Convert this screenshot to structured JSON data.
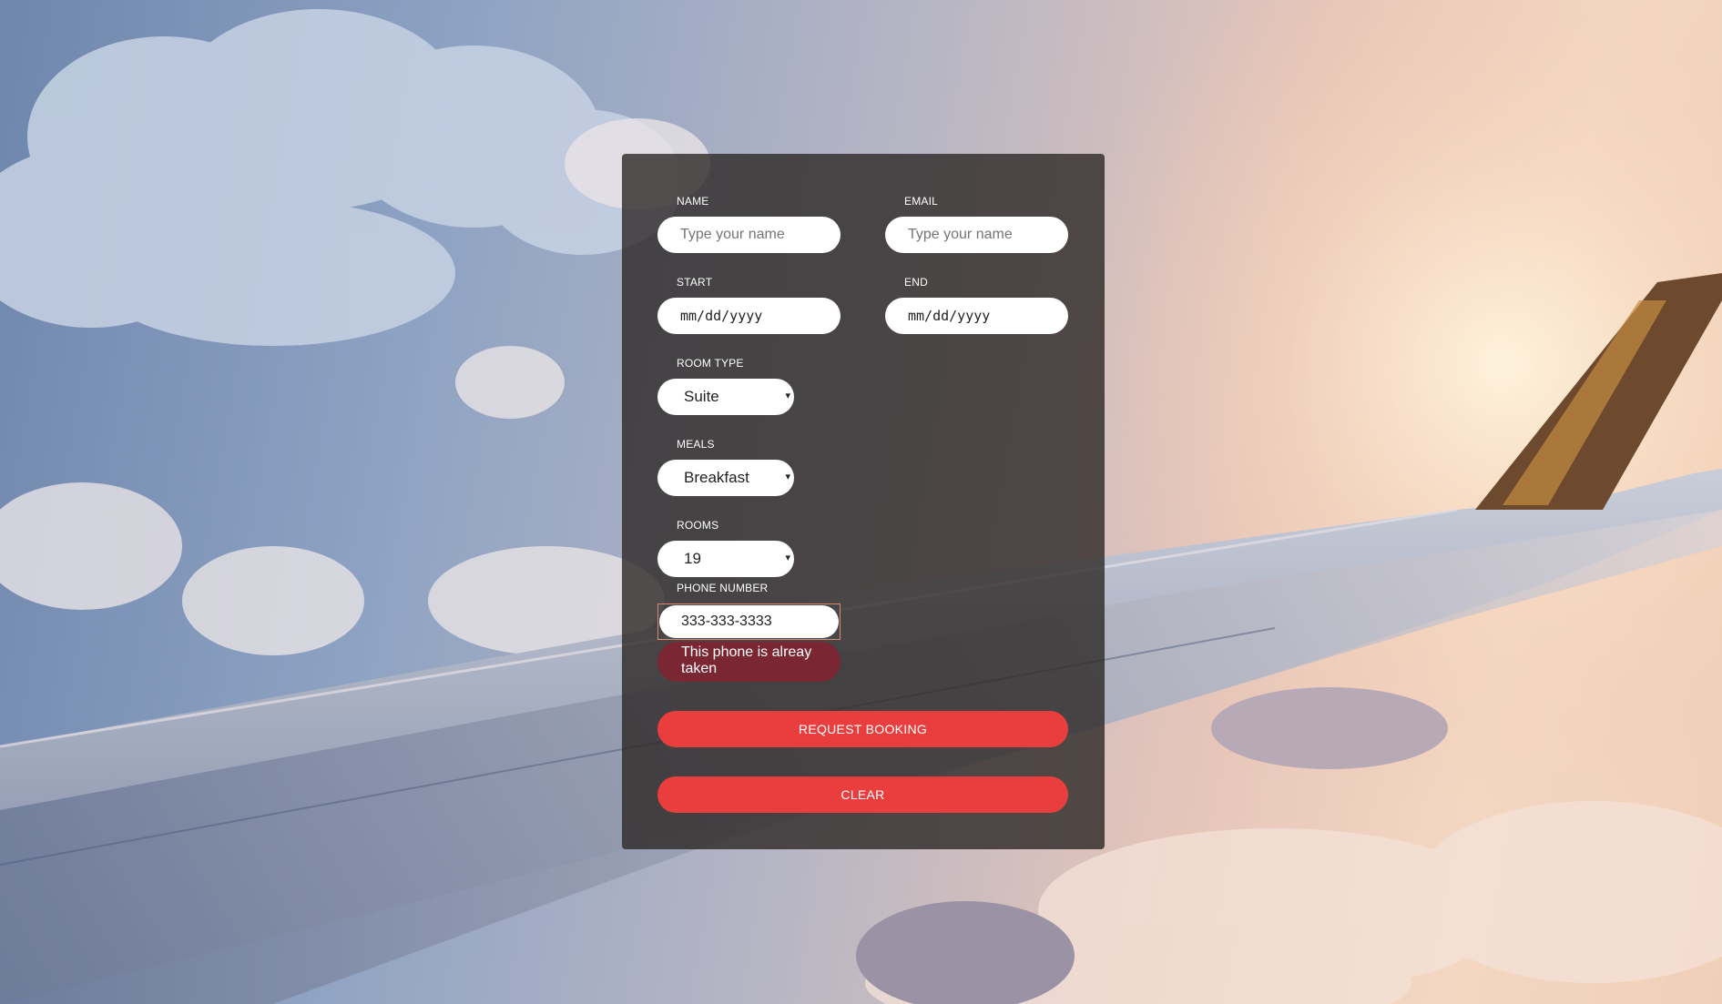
{
  "form": {
    "name": {
      "label": "NAME",
      "placeholder": "Type your name",
      "value": ""
    },
    "email": {
      "label": "EMAIL",
      "placeholder": "Type your name",
      "value": ""
    },
    "start": {
      "label": "START",
      "value": "mm/dd/yyyy"
    },
    "end": {
      "label": "END",
      "value": "mm/dd/yyyy"
    },
    "room_type": {
      "label": "ROOM TYPE",
      "selected": "Suite"
    },
    "meals": {
      "label": "MEALS",
      "selected": "Breakfast"
    },
    "rooms": {
      "label": "ROOMS",
      "selected": "19"
    },
    "phone": {
      "label": "PHONE NUMBER",
      "value": "333-333-3333",
      "error": "This phone is alreay taken"
    },
    "buttons": {
      "request": "REQUEST BOOKING",
      "clear": "CLEAR"
    },
    "dropdown_arrow_icon": "▾"
  },
  "colors": {
    "button": "#ea3e3e",
    "error_background": "#7a2633",
    "panel": "rgba(45,40,38,0.8)"
  }
}
